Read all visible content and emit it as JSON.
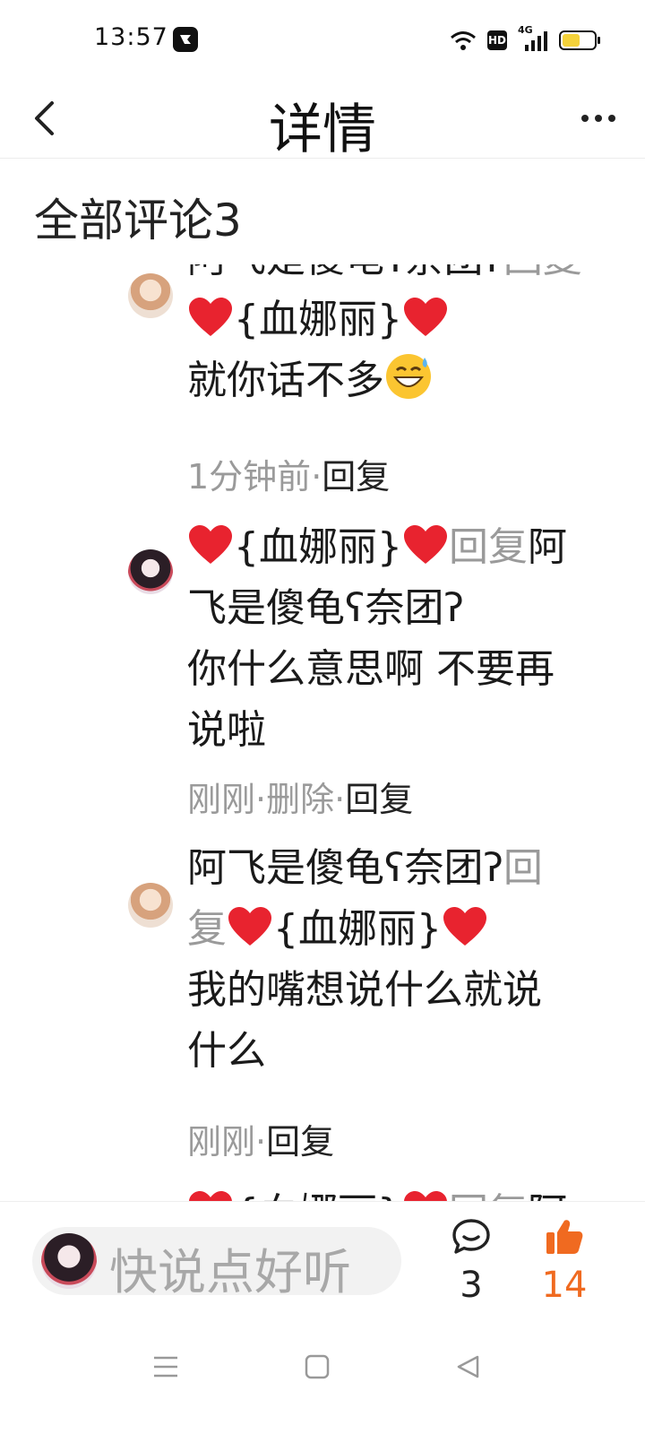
{
  "status_bar": {
    "time": "13:57",
    "hd_label": "HD",
    "network_label": "4G"
  },
  "header": {
    "title": "详情"
  },
  "comments_section": {
    "title": "全部评论3"
  },
  "comments": [
    {
      "author_text": "阿飞是傻龟ʕ奈团ʔ",
      "reply_word": "回复",
      "target": "{血娜丽}",
      "body": "就你话不多",
      "time": "1分钟前",
      "actions": [
        "回复"
      ]
    },
    {
      "author_text": "{血娜丽}",
      "reply_word": "回复",
      "target_line1": "阿",
      "target_line2": "飞是傻龟ʕ奈团ʔ",
      "body_line1": "你什么意思啊 不要再",
      "body_line2": "说啦",
      "time": "刚刚",
      "actions": [
        "删除",
        "回复"
      ]
    },
    {
      "author_text": "阿飞是傻龟ʕ奈团ʔ",
      "reply_word_line1": "回",
      "reply_word_line2": "复",
      "target": "{血娜丽}",
      "body_line1": "我的嘴想说什么就说",
      "body_line2": "什么",
      "time": "刚刚",
      "actions": [
        "回复"
      ]
    },
    {
      "partial_text": "{血娜丽}",
      "reply_word": "回复",
      "target": "阿"
    }
  ],
  "bottom_bar": {
    "input_placeholder": "快说点好听",
    "comment_count": "3",
    "like_count": "14"
  },
  "colors": {
    "heart": "#e8232f",
    "like_accent": "#f06a20",
    "muted_text": "#9a9a9a"
  },
  "icons": [
    "back-icon",
    "more-icon",
    "heart-emoji",
    "grin-sweat-emoji",
    "comment-icon",
    "thumbs-up-icon",
    "menu-nav-icon",
    "home-nav-icon",
    "back-nav-icon"
  ]
}
